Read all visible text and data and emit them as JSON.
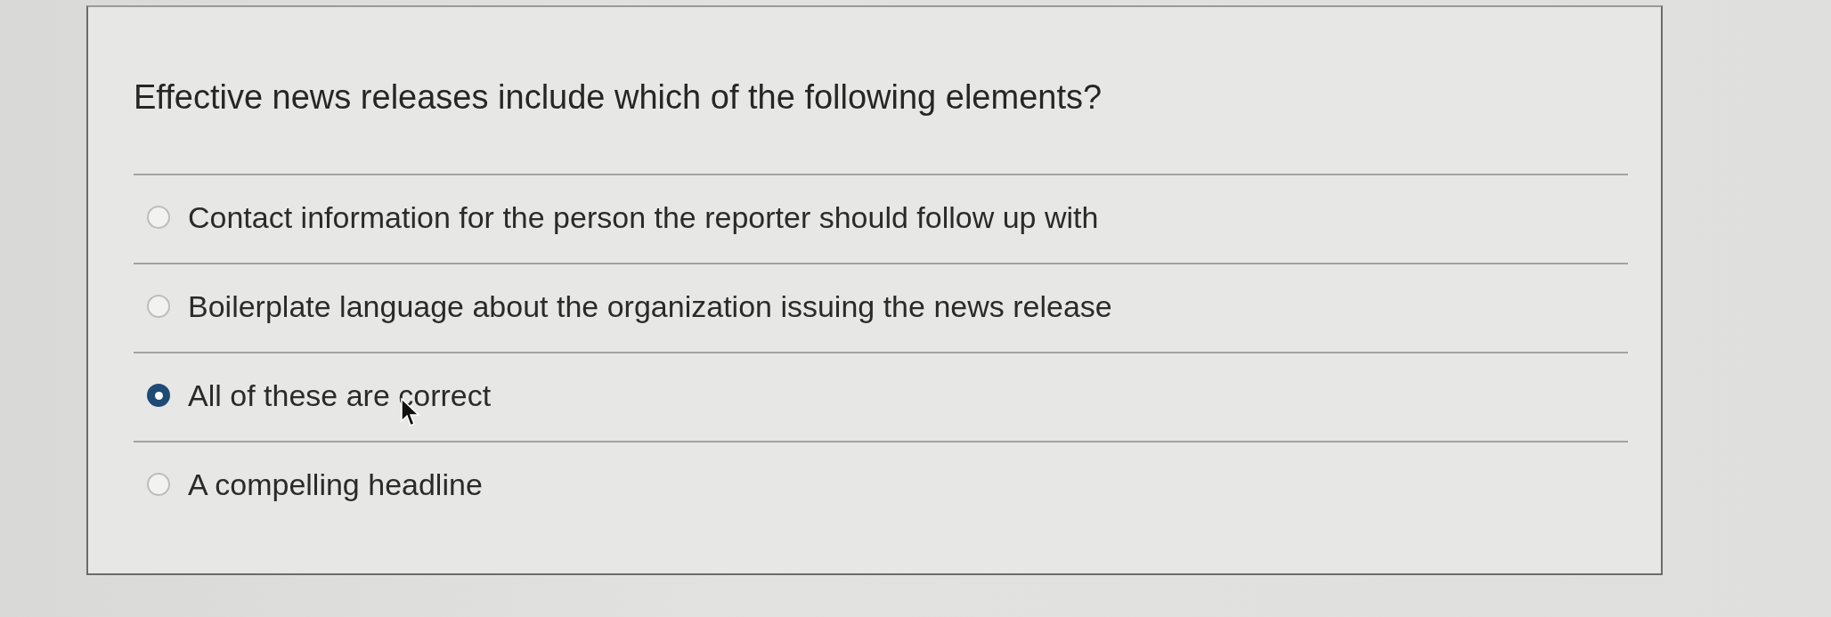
{
  "question": {
    "text": "Effective news releases include which of the following elements?"
  },
  "options": [
    {
      "label": "Contact information for the person the reporter should follow up with",
      "selected": false
    },
    {
      "label": "Boilerplate language about the organization issuing the news release",
      "selected": false
    },
    {
      "label": "All of these are correct",
      "selected": true
    },
    {
      "label": "A compelling headline",
      "selected": false
    }
  ]
}
